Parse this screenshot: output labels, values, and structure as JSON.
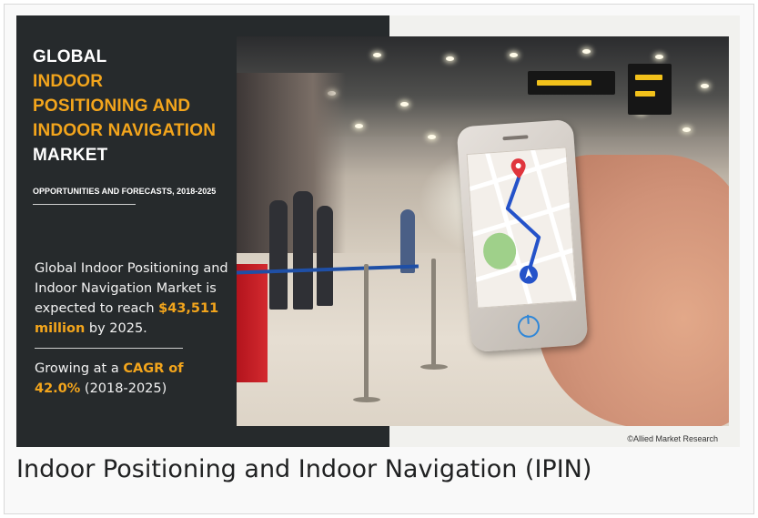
{
  "infographic": {
    "heading_line1": "GLOBAL",
    "heading_line2": "INDOOR",
    "heading_line3": "POSITIONING AND",
    "heading_line4": "INDOOR NAVIGATION",
    "heading_line5": "MARKET",
    "subheading": "OPPORTUNITIES AND FORECASTS, 2018-2025",
    "stat1": {
      "line1": "Global Indoor Positioning and",
      "line2": "Indoor Navigation Market is",
      "line3_pre": "expected to reach ",
      "value": "$43,511",
      "value_unit": "million",
      "line4_post": " by 2025."
    },
    "stat2": {
      "pre": "Growing at a ",
      "cagr_label": "CAGR of",
      "cagr_value": "42.0%",
      "period": " (2018-2025)"
    },
    "copyright": "©Allied Market Research",
    "colors": {
      "panel": "#262a2c",
      "accent": "#f3a51c",
      "route": "#2452c9",
      "pin": "#e0353d"
    }
  },
  "caption": "Indoor Positioning and Indoor Navigation (IPIN)"
}
